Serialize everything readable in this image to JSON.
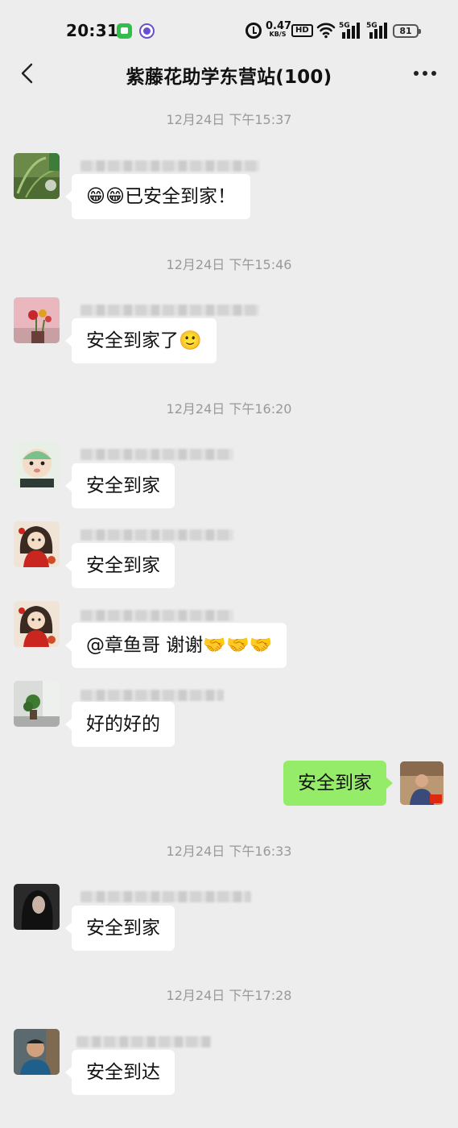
{
  "status_bar": {
    "time": "20:31",
    "net_speed_value": "0.47",
    "net_speed_unit": "KB/S",
    "hd_label": "HD",
    "sim1_label": "5G",
    "sim2_label": "5G",
    "battery": "81"
  },
  "nav": {
    "title": "紫藤花助学东营站(100)"
  },
  "messages": [
    {
      "type": "time",
      "text": "12月24日 下午15:37"
    },
    {
      "type": "msg",
      "avatar": "plant-photo-avatar",
      "text": "😁😁已安全到家！"
    },
    {
      "type": "time",
      "text": "12月24日 下午15:46"
    },
    {
      "type": "msg",
      "avatar": "flowers-avatar",
      "text": "安全到家了🙂"
    },
    {
      "type": "time",
      "text": "12月24日 下午16:20"
    },
    {
      "type": "msg",
      "avatar": "baby-avatar",
      "text": "安全到家"
    },
    {
      "type": "msg",
      "avatar": "cartoon-girl-avatar",
      "text": "安全到家"
    },
    {
      "type": "msg",
      "avatar": "cartoon-girl-avatar",
      "text": "@章鱼哥  谢谢🤝🤝🤝"
    },
    {
      "type": "msg",
      "avatar": "office-plant-avatar",
      "text": "好的好的"
    },
    {
      "type": "msg_self",
      "avatar": "self-avatar",
      "text": "安全到家"
    },
    {
      "type": "time",
      "text": "12月24日 下午16:33"
    },
    {
      "type": "msg",
      "avatar": "dark-hair-avatar",
      "text": "安全到家"
    },
    {
      "type": "time",
      "text": "12月24日 下午17:28"
    },
    {
      "type": "msg",
      "avatar": "man-avatar",
      "text": "安全到达"
    }
  ],
  "colors": {
    "background": "#ededed",
    "self_bubble": "#95ec69",
    "other_bubble": "#ffffff",
    "timestamp_text": "#999999"
  }
}
